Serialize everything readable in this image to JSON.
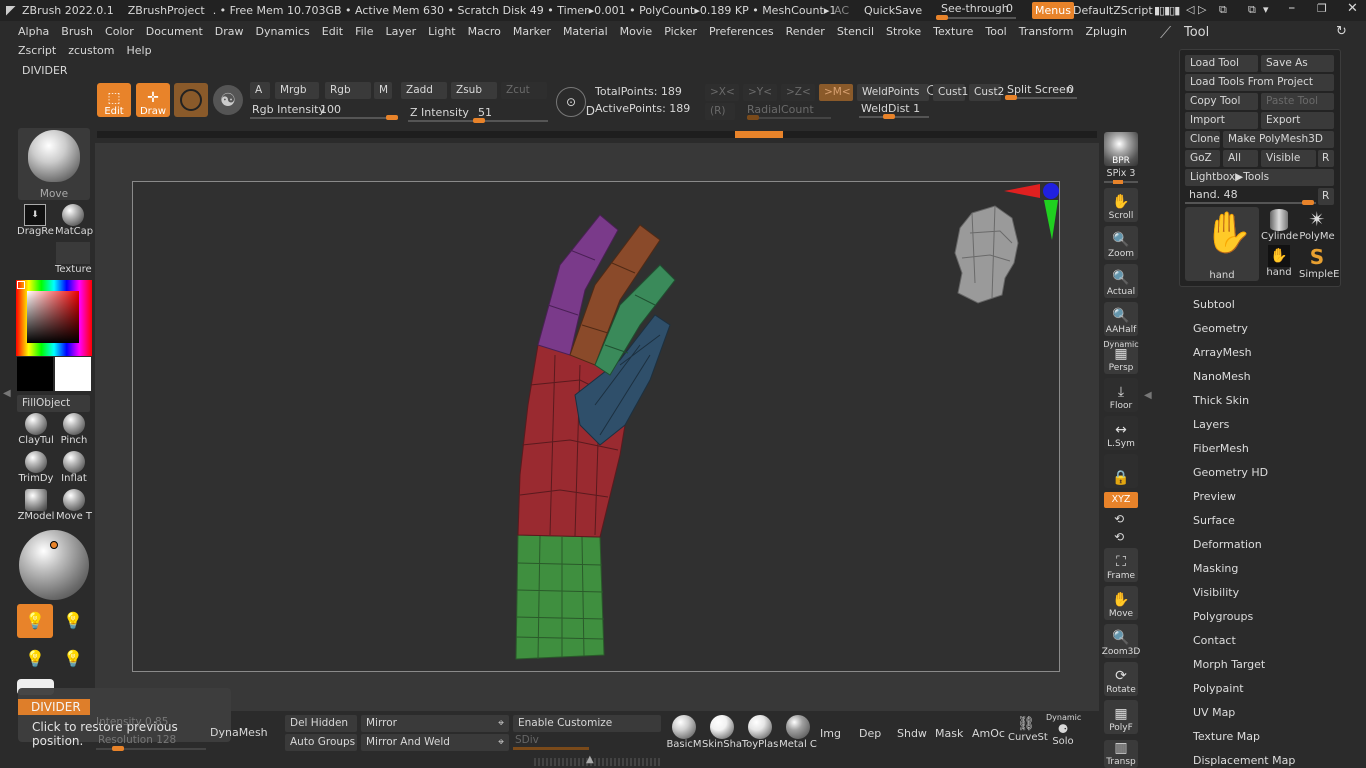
{
  "titlebar": {
    "app": "ZBrush 2022.0.1",
    "project": "ZBrushProject",
    "stats": ". • Free Mem 10.703GB • Active Mem 630 • Scratch Disk 49 •  Timer▸0.001 • PolyCount▸0.189 KP  • MeshCount▸1",
    "ac": "AC",
    "quicksave": "QuickSave",
    "seethrough_label": "See-through",
    "seethrough_value": "0",
    "menus_button": "Menus",
    "script": "DefaultZScript"
  },
  "menubar": [
    "Alpha",
    "Brush",
    "Color",
    "Document",
    "Draw",
    "Dynamics",
    "Edit",
    "File",
    "Layer",
    "Light",
    "Macro",
    "Marker",
    "Material",
    "Movie",
    "Picker",
    "Preferences",
    "Render",
    "Stencil",
    "Stroke",
    "Texture",
    "Tool",
    "Transform",
    "Zplugin"
  ],
  "menubar2": [
    "Zscript",
    "zcustom",
    "Help"
  ],
  "divider_label": "DIVIDER",
  "toolbar": {
    "edit": "Edit",
    "draw": "Draw",
    "a": "A",
    "mrgb": "Mrgb",
    "rgb": "Rgb",
    "m": "M",
    "zadd": "Zadd",
    "zsub": "Zsub",
    "zcut": "Zcut",
    "rgb_intensity_label": "Rgb Intensity",
    "rgb_intensity": "100",
    "rgb_intensity_frac": 1.0,
    "z_intensity_label": "Z Intensity",
    "z_intensity": "51",
    "z_intensity_frac": 0.51,
    "d": "D",
    "totalpoints": "TotalPoints: 189",
    "activepoints": "ActivePoints: 189",
    "sym_x": ">X<",
    "sym_y": ">Y<",
    "sym_z": ">Z<",
    "sym_m": ">M<",
    "r": "(R)",
    "radialcount": "RadialCount",
    "weldpoints": "WeldPoints",
    "welddist": "WeldDist 1",
    "cust1": "Cust1",
    "cust2": "Cust2",
    "split_screen": "Split Screen",
    "split_value": "0"
  },
  "left": {
    "brush_label": "Move",
    "dragrect": "DragRe",
    "matcap": "MatCap",
    "texture": "Texture",
    "fillobject": "FillObject",
    "brushes": [
      "ClayTul",
      "Pinch",
      "TrimDy",
      "Inflat",
      "ZModel",
      "Move T"
    ]
  },
  "bottom": {
    "divider": "DIVIDER",
    "tooltip": "Click to restore previous position.",
    "intensity": "Intensity 0.85",
    "resolution": "Resolution 128",
    "dynamesh": "DynaMesh",
    "del_hidden": "Del Hidden",
    "auto_groups": "Auto Groups",
    "mirror": "Mirror",
    "mirror_weld": "Mirror And Weld",
    "enable_customize": "Enable Customize",
    "sdiv": "SDiv",
    "materials": [
      "BasicM",
      "SkinSha",
      "ToyPlas",
      "Metal C"
    ],
    "img": "Img",
    "dep": "Dep",
    "shdw": "Shdw",
    "mask": "Mask",
    "amoc": "AmOc",
    "curvest": "CurveSt",
    "dynamic": "Dynamic",
    "solo": "Solo"
  },
  "rightshelf": {
    "bpr": "BPR",
    "spix": "SPix 3",
    "scroll": "Scroll",
    "zoom": "Zoom",
    "actual": "Actual",
    "aahalf": "AAHalf",
    "dynamic": "Dynamic",
    "persp": "Persp",
    "floor": "Floor",
    "lsym": "L.Sym",
    "xyz": "XYZ",
    "frame": "Frame",
    "move": "Move",
    "zoom3d": "Zoom3D",
    "rotate": "Rotate",
    "polyf": "PolyF",
    "transp": "Transp"
  },
  "tool": {
    "title": "Tool",
    "load_tool": "Load Tool",
    "save_as": "Save As",
    "load_from_project": "Load Tools From Project",
    "copy_tool": "Copy Tool",
    "paste_tool": "Paste Tool",
    "import": "Import",
    "export": "Export",
    "clone": "Clone",
    "make_polymesh": "Make PolyMesh3D",
    "goz": "GoZ",
    "all": "All",
    "visible": "Visible",
    "r": "R",
    "lightbox": "Lightbox▶Tools",
    "current_tool": "hand. 48",
    "thumbs": [
      "hand",
      "Cylinde",
      "PolyMe",
      "hand",
      "SimpleE"
    ],
    "subpalettes": [
      "Subtool",
      "Geometry",
      "ArrayMesh",
      "NanoMesh",
      "Thick Skin",
      "Layers",
      "FiberMesh",
      "Geometry HD",
      "Preview",
      "Surface",
      "Deformation",
      "Masking",
      "Visibility",
      "Polygroups",
      "Contact",
      "Morph Target",
      "Polypaint",
      "UV Map",
      "Texture Map",
      "Displacement Map"
    ]
  },
  "colors": {
    "accent": "#e8832a",
    "background": "#2b2b2b",
    "canvas": "#383838"
  }
}
